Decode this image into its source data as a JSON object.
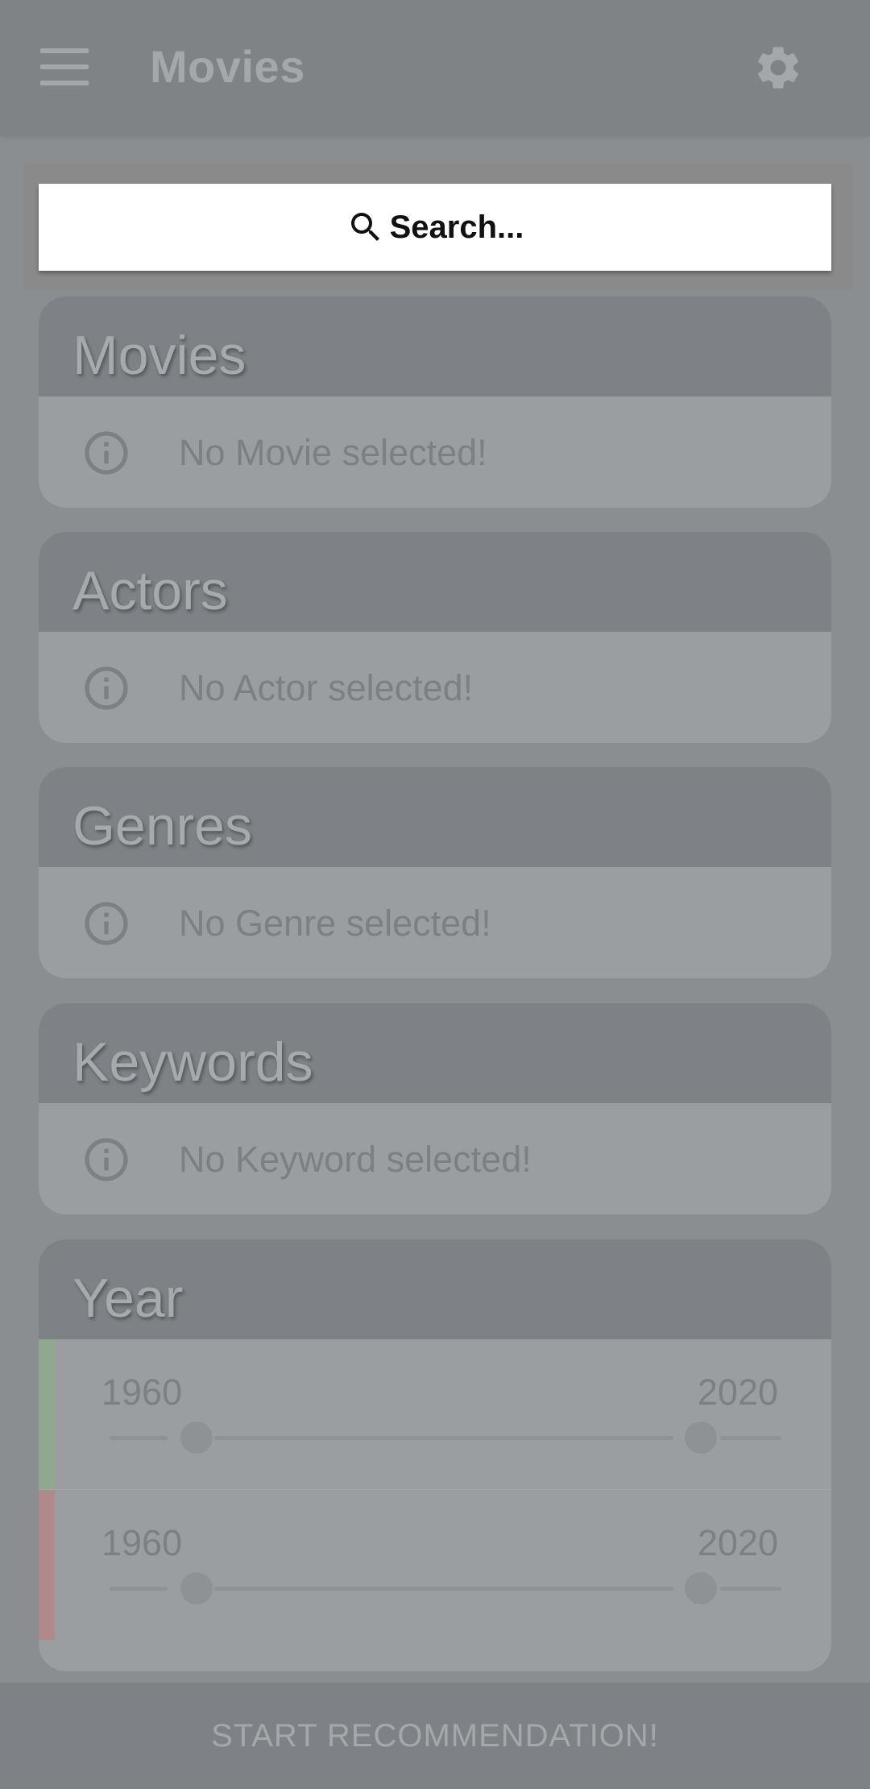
{
  "appbar": {
    "title": "Movies",
    "menu_icon": "menu-icon",
    "settings_icon": "gear-icon"
  },
  "search": {
    "placeholder": "Search...",
    "icon": "search-icon"
  },
  "sections": [
    {
      "title": "Movies",
      "empty_text": "No Movie selected!",
      "icon": "info-icon"
    },
    {
      "title": "Actors",
      "empty_text": "No Actor selected!",
      "icon": "info-icon"
    },
    {
      "title": "Genres",
      "empty_text": "No Genre selected!",
      "icon": "info-icon"
    },
    {
      "title": "Keywords",
      "empty_text": "No Keyword selected!",
      "icon": "info-icon"
    }
  ],
  "year": {
    "title": "Year",
    "include_range": {
      "min_label": "1960",
      "max_label": "2020",
      "min": 1960,
      "max": 2020,
      "indicator_color": "#8fa88f"
    },
    "exclude_range": {
      "min_label": "1960",
      "max_label": "2020",
      "min": 1960,
      "max": 2020,
      "indicator_color": "#b08a8a"
    }
  },
  "bottom_button": {
    "label": "START RECOMMENDATION!"
  },
  "colors": {
    "overlay_background": "#8b8e90",
    "header": "#7e8286",
    "card_body": "#9b9ea0",
    "search_background": "#ffffff"
  }
}
